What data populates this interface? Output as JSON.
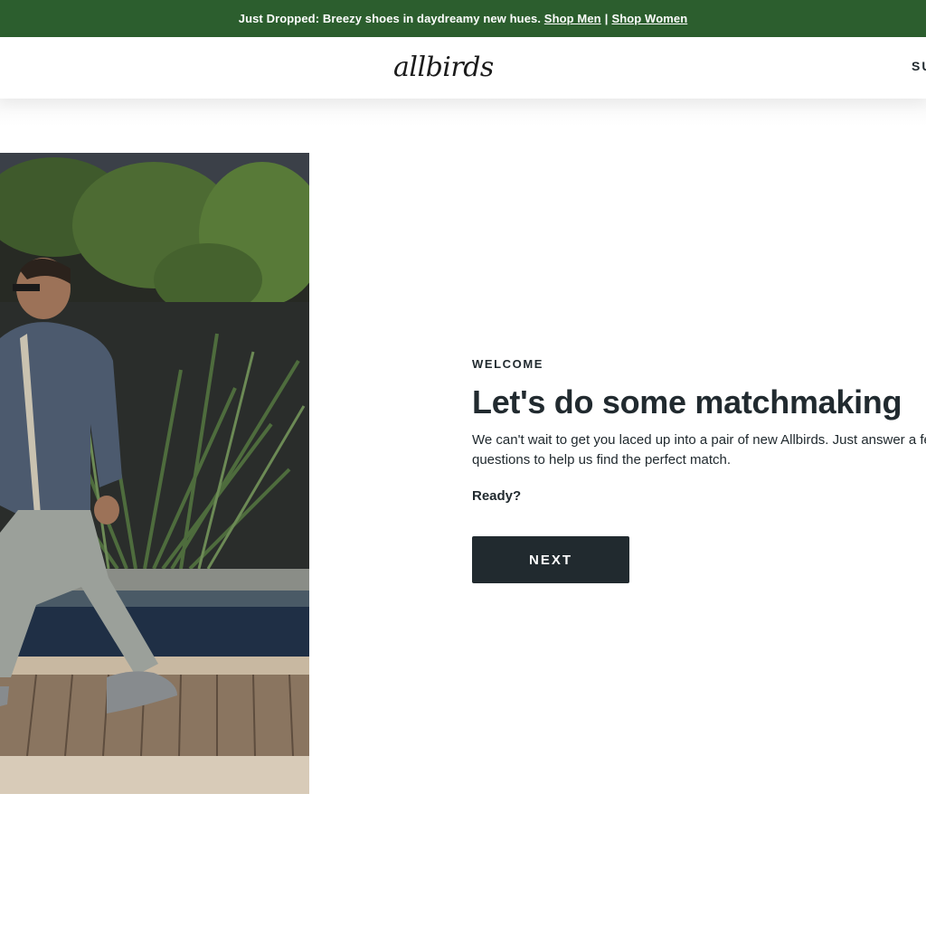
{
  "promo_bar": {
    "text": "Just Dropped: Breezy shoes in daydreamy new hues.",
    "shop_men": "Shop Men",
    "separator": "|",
    "shop_women": "Shop Women",
    "background": "#2c5e2e"
  },
  "header": {
    "logo": "allbirds",
    "nav_partial": "SU"
  },
  "hero_image": {
    "alt": "Man walking by poolside wearing grey sneakers"
  },
  "welcome": {
    "eyebrow": "WELCOME",
    "headline": "Let's do some matchmaking",
    "body_line1": "We can't wait to get you laced up into a pair of new Allbirds. Just answer a few",
    "body_line2": "questions to help us find the perfect match.",
    "ready": "Ready?",
    "next_label": "NEXT"
  },
  "colors": {
    "text": "#212a2f",
    "button": "#212a2f"
  }
}
